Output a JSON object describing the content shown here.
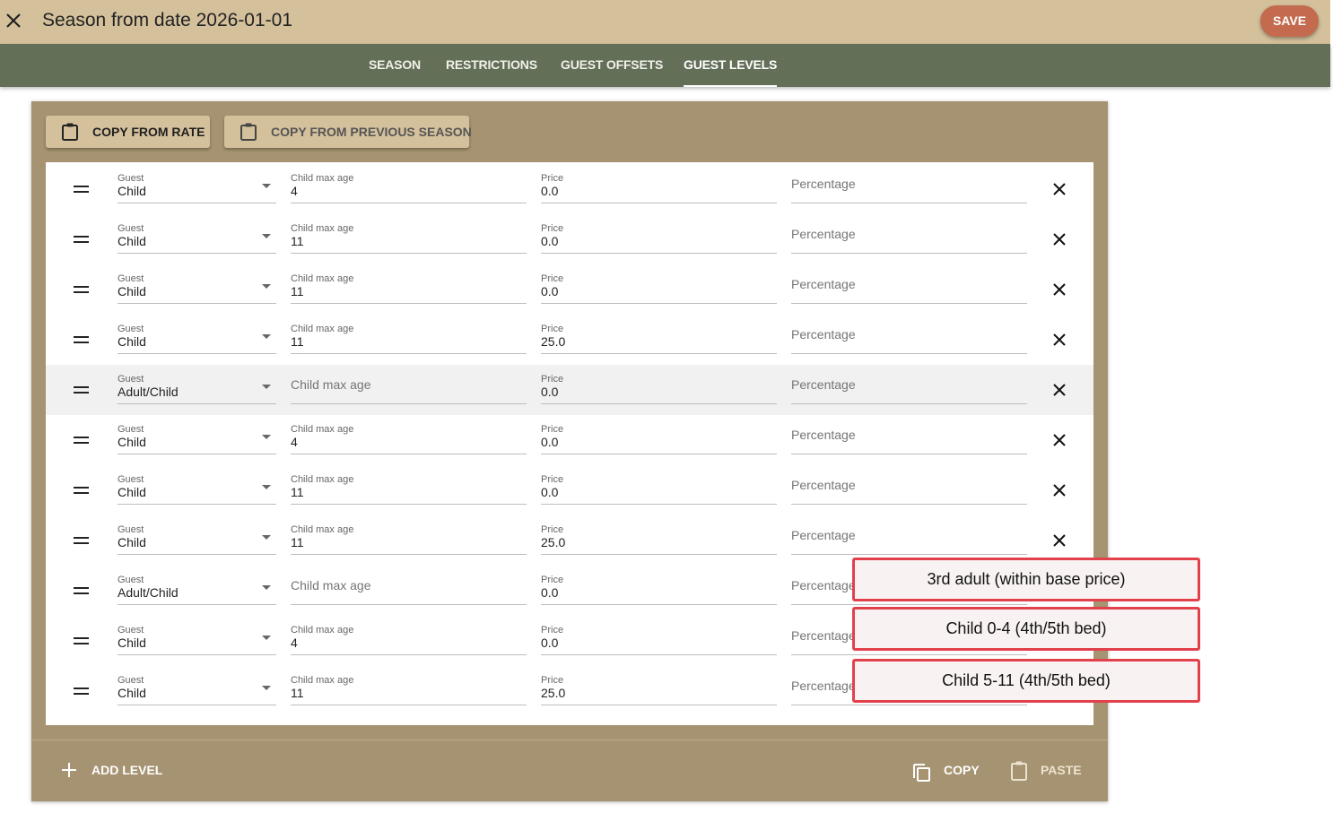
{
  "header": {
    "title": "Season from date 2026-01-01",
    "save_label": "SAVE"
  },
  "tabs": [
    {
      "label": "SEASON",
      "active": false
    },
    {
      "label": "RESTRICTIONS",
      "active": false
    },
    {
      "label": "GUEST OFFSETS",
      "active": false
    },
    {
      "label": "GUEST LEVELS",
      "active": true
    }
  ],
  "toolbar": {
    "copy_from_rate": "COPY FROM RATE",
    "copy_from_previous": "COPY FROM PREVIOUS SEASON"
  },
  "labels": {
    "guest": "Guest",
    "child_max_age": "Child max age",
    "price": "Price",
    "percentage": "Percentage"
  },
  "levels": [
    {
      "guest": "Child",
      "child_max_age": "4",
      "price": "0.0",
      "percentage": ""
    },
    {
      "guest": "Child",
      "child_max_age": "11",
      "price": "0.0",
      "percentage": ""
    },
    {
      "guest": "Child",
      "child_max_age": "11",
      "price": "0.0",
      "percentage": ""
    },
    {
      "guest": "Child",
      "child_max_age": "11",
      "price": "25.0",
      "percentage": ""
    },
    {
      "guest": "Adult/Child",
      "child_max_age": "",
      "price": "0.0",
      "percentage": "",
      "highlighted": true
    },
    {
      "guest": "Child",
      "child_max_age": "4",
      "price": "0.0",
      "percentage": ""
    },
    {
      "guest": "Child",
      "child_max_age": "11",
      "price": "0.0",
      "percentage": ""
    },
    {
      "guest": "Child",
      "child_max_age": "11",
      "price": "25.0",
      "percentage": ""
    },
    {
      "guest": "Adult/Child",
      "child_max_age": "",
      "price": "0.0",
      "percentage": ""
    },
    {
      "guest": "Child",
      "child_max_age": "4",
      "price": "0.0",
      "percentage": ""
    },
    {
      "guest": "Child",
      "child_max_age": "11",
      "price": "25.0",
      "percentage": ""
    }
  ],
  "footer": {
    "add_level": "ADD LEVEL",
    "copy": "COPY",
    "paste": "PASTE"
  },
  "annotations": [
    "3rd adult (within base price)",
    "Child 0-4 (4th/5th bed)",
    "Child 5-11 (4th/5th bed)"
  ],
  "colors": {
    "header_bg": "#d4c19c",
    "tabbar_bg": "#646f58",
    "card_bg": "#a69371",
    "save_button": "#c46a4e",
    "annotation_border": "#e2414c"
  }
}
